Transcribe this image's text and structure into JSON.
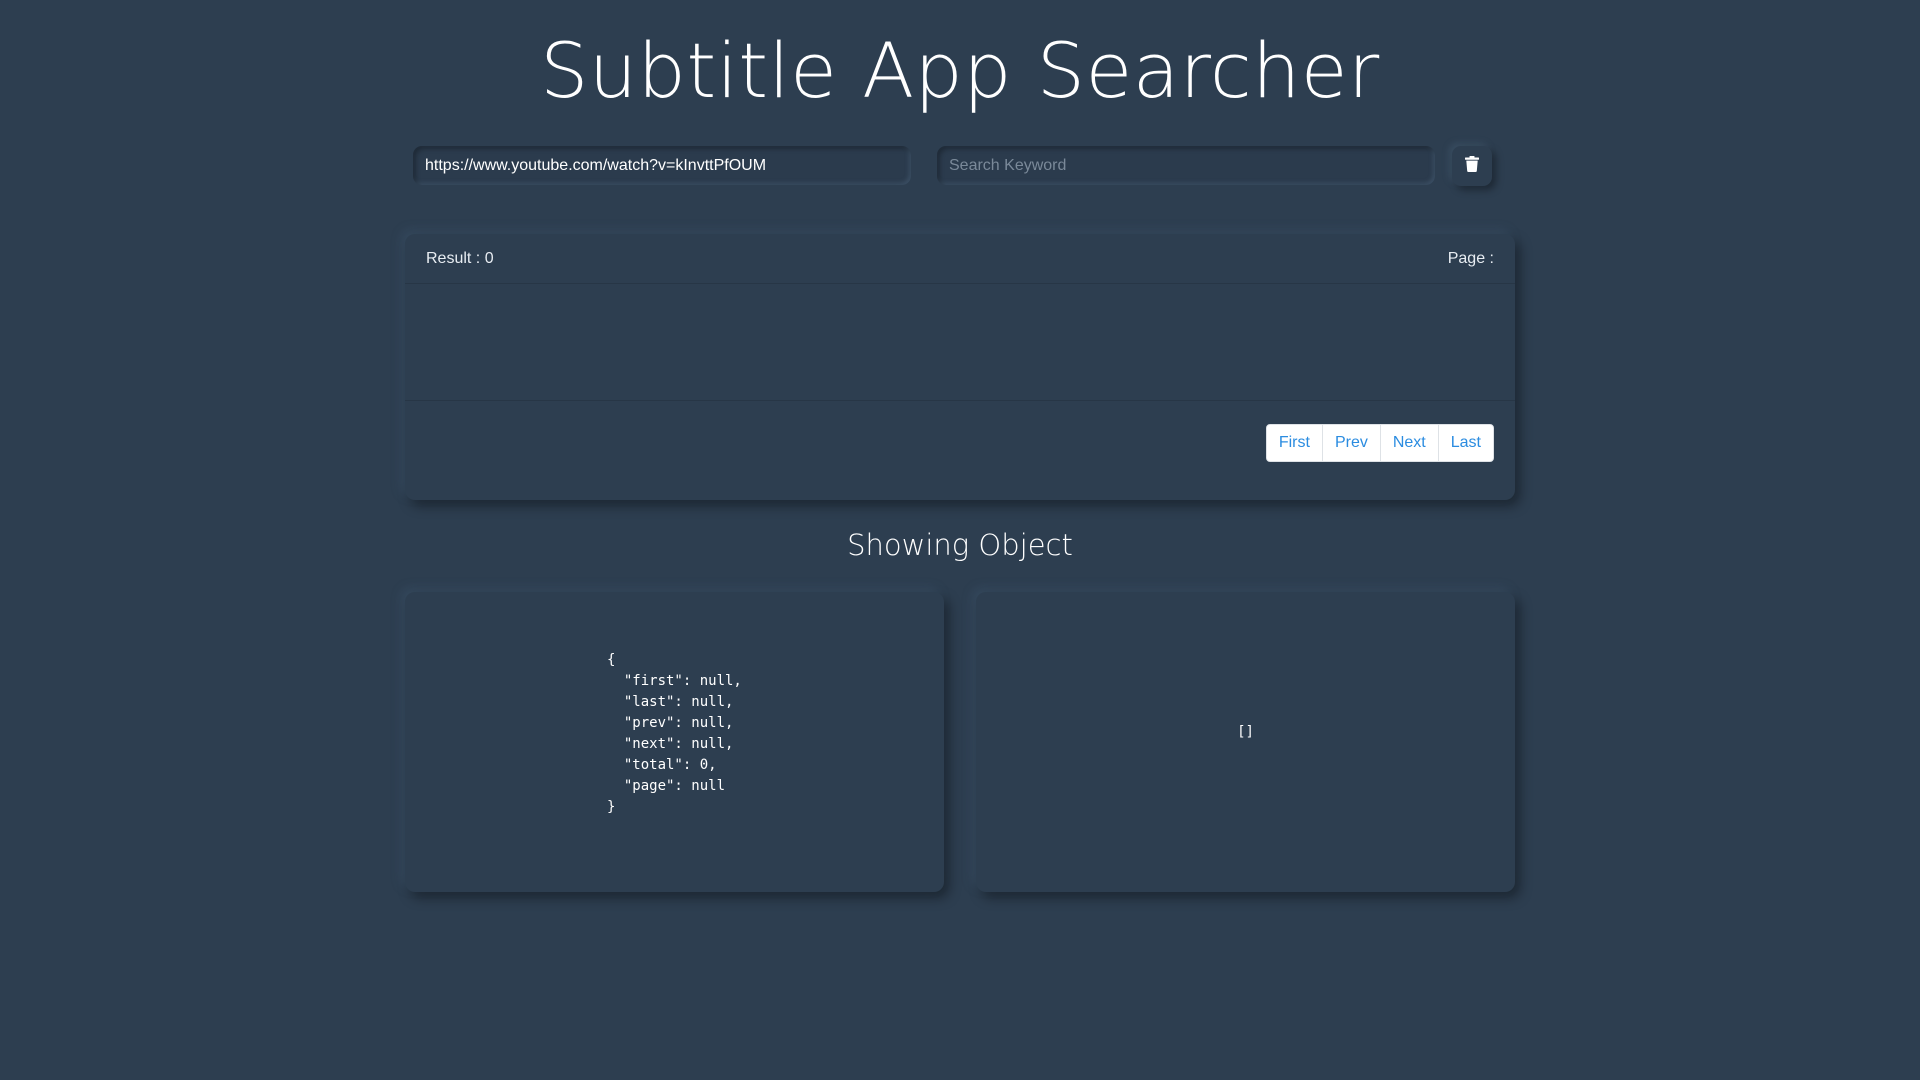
{
  "header": {
    "title": "Subtitle App Searcher"
  },
  "search": {
    "url_value": "https://www.youtube.com/watch?v=kInvttPfOUM",
    "keyword_value": "",
    "keyword_placeholder": "Search Keyword",
    "delete_icon": "trash-icon"
  },
  "results": {
    "result_label": "Result : 0",
    "page_label": "Page :",
    "pagination": {
      "first": "First",
      "prev": "Prev",
      "next": "Next",
      "last": "Last"
    }
  },
  "object_section": {
    "title": "Showing Object",
    "left_json": "{\n  \"first\": null,\n  \"last\": null,\n  \"prev\": null,\n  \"next\": null,\n  \"total\": 0,\n  \"page\": null\n}",
    "right_json": "[]"
  },
  "colors": {
    "background": "#2d3e50",
    "link": "#2b8ce0",
    "text": "#ffffff"
  }
}
